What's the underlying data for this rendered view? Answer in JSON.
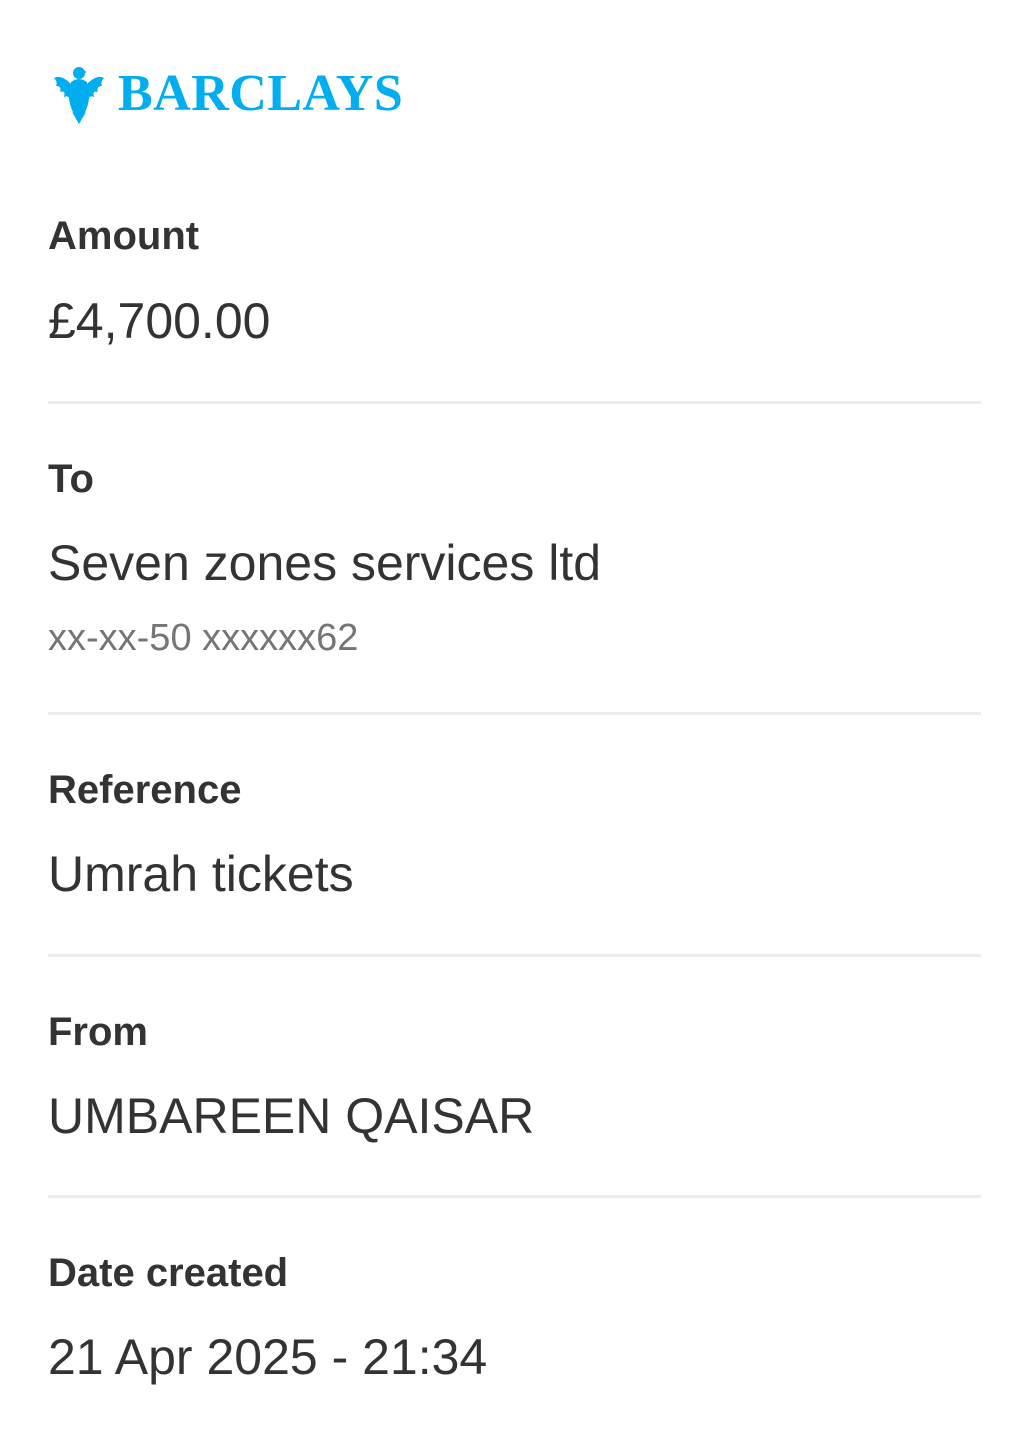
{
  "brand": {
    "name": "BARCLAYS",
    "color": "#00AEEF",
    "logo_icon": "eagle-icon"
  },
  "payment": {
    "amount_label": "Amount",
    "amount_value": "£4,700.00",
    "to_label": "To",
    "to_name": "Seven zones services ltd",
    "to_account": "xx-xx-50 xxxxxx62",
    "reference_label": "Reference",
    "reference_value": "Umrah tickets",
    "from_label": "From",
    "from_name": "UMBAREEN QAISAR",
    "date_label": "Date created",
    "date_value": "21 Apr 2025 - 21:34"
  },
  "colors": {
    "text": "#333333",
    "muted": "#757575",
    "divider": "#ececec"
  }
}
